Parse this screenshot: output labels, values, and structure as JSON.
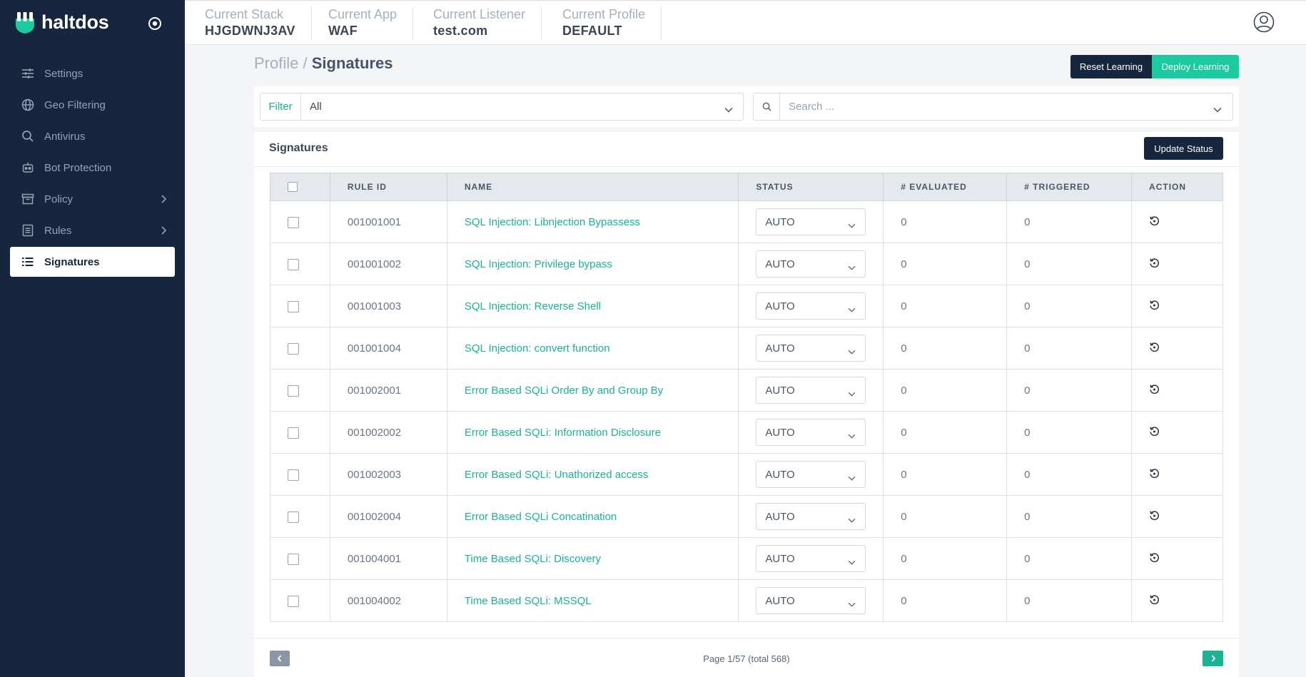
{
  "brand": {
    "name": "haltdos"
  },
  "sidebar": {
    "items": [
      {
        "label": "Settings",
        "icon": "sliders-icon"
      },
      {
        "label": "Geo Filtering",
        "icon": "globe-icon"
      },
      {
        "label": "Antivirus",
        "icon": "search-icon"
      },
      {
        "label": "Bot Protection",
        "icon": "robot-icon"
      },
      {
        "label": "Policy",
        "icon": "archive-icon",
        "has_submenu": true
      },
      {
        "label": "Rules",
        "icon": "list-doc-icon",
        "has_submenu": true
      },
      {
        "label": "Signatures",
        "icon": "list-icon",
        "active": true
      }
    ]
  },
  "topbar": {
    "current_stack": {
      "label": "Current Stack",
      "value": "HJGDWNJ3AV"
    },
    "current_app": {
      "label": "Current App",
      "value": "WAF"
    },
    "current_listener": {
      "label": "Current Listener",
      "value": "test.com"
    },
    "current_profile": {
      "label": "Current Profile",
      "value": "DEFAULT"
    }
  },
  "breadcrumb": {
    "parent": "Profile",
    "separator": "/",
    "current": "Signatures"
  },
  "actions": {
    "reset_learning": "Reset Learning",
    "deploy_learning": "Deploy Learning"
  },
  "filter": {
    "label": "Filter",
    "selected": "All"
  },
  "search": {
    "placeholder": "Search ..."
  },
  "card": {
    "title": "Signatures",
    "update_status": "Update Status"
  },
  "table": {
    "columns": [
      "RULE ID",
      "NAME",
      "STATUS",
      "# EVALUATED",
      "# TRIGGERED",
      "ACTION"
    ],
    "rows": [
      {
        "rule_id": "001001001",
        "name": "SQL Injection: Libnjection Bypassess",
        "status": "AUTO",
        "evaluated": "0",
        "triggered": "0"
      },
      {
        "rule_id": "001001002",
        "name": "SQL Injection: Privilege bypass",
        "status": "AUTO",
        "evaluated": "0",
        "triggered": "0"
      },
      {
        "rule_id": "001001003",
        "name": "SQL Injection: Reverse Shell",
        "status": "AUTO",
        "evaluated": "0",
        "triggered": "0"
      },
      {
        "rule_id": "001001004",
        "name": "SQL Injection: convert function",
        "status": "AUTO",
        "evaluated": "0",
        "triggered": "0"
      },
      {
        "rule_id": "001002001",
        "name": "Error Based SQLi Order By and Group By",
        "status": "AUTO",
        "evaluated": "0",
        "triggered": "0"
      },
      {
        "rule_id": "001002002",
        "name": "Error Based SQLi: Information Disclosure",
        "status": "AUTO",
        "evaluated": "0",
        "triggered": "0"
      },
      {
        "rule_id": "001002003",
        "name": "Error Based SQLi: Unathorized access",
        "status": "AUTO",
        "evaluated": "0",
        "triggered": "0"
      },
      {
        "rule_id": "001002004",
        "name": "Error Based SQLi Concatination",
        "status": "AUTO",
        "evaluated": "0",
        "triggered": "0"
      },
      {
        "rule_id": "001004001",
        "name": "Time Based SQLi: Discovery",
        "status": "AUTO",
        "evaluated": "0",
        "triggered": "0"
      },
      {
        "rule_id": "001004002",
        "name": "Time Based SQLi: MSSQL",
        "status": "AUTO",
        "evaluated": "0",
        "triggered": "0"
      }
    ]
  },
  "pagination": {
    "info": "Page 1/57 (total 568)"
  },
  "colors": {
    "sidebar_bg": "#16263f",
    "accent": "#1ccaa0",
    "link": "#1ab394"
  }
}
